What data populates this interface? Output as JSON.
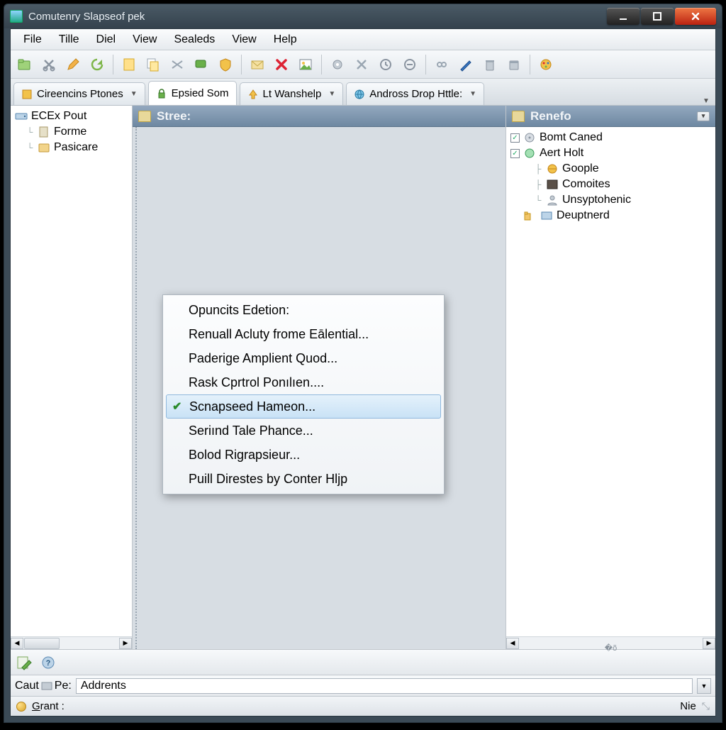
{
  "window": {
    "title": "Comutenry Slapseof pek"
  },
  "menubar": [
    "File",
    "Tille",
    "Diel",
    "View",
    "Sealeds",
    "View",
    "Help"
  ],
  "tabs": [
    {
      "label": "Cireencins Ptones",
      "active": false,
      "icon": "book-icon",
      "hasDropdown": true
    },
    {
      "label": "Epsied Som",
      "active": true,
      "icon": "lock-icon",
      "hasDropdown": false
    },
    {
      "label": "Lt Wanshelp",
      "active": false,
      "icon": "arrow-up-icon",
      "hasDropdown": true
    },
    {
      "label": "Andross Drop Httle:",
      "active": false,
      "icon": "globe-icon",
      "hasDropdown": true
    }
  ],
  "left_tree": [
    {
      "label": "ECEx Pout",
      "icon": "drive-icon",
      "depth": 0
    },
    {
      "label": "Forme",
      "icon": "page-icon",
      "depth": 1
    },
    {
      "label": "Pasicare",
      "icon": "box-icon",
      "depth": 1
    }
  ],
  "mid_header": "Stree:",
  "context_menu": {
    "items": [
      "Opuncits Edetion:",
      "Renuall Acluty frome Eālential...",
      "Paderige Amplient Quod...",
      "Rask Cprtrol Ponılıen....",
      "Scnapseed Hameon...",
      "Seriınd Tale Phance...",
      "Bolod Rigrapsieur...",
      "Puill Direstes by Conter Hljp"
    ],
    "selected_index": 4
  },
  "right_header": "Renefo",
  "right_tree": [
    {
      "label": "Bomt Caned",
      "icon": "disc-icon",
      "depth": 0,
      "checked": true
    },
    {
      "label": "Aert Holt",
      "icon": "globe2-icon",
      "depth": 0,
      "checked": true
    },
    {
      "label": "Goople",
      "icon": "world-icon",
      "depth": 1
    },
    {
      "label": "Comoites",
      "icon": "photo-icon",
      "depth": 1
    },
    {
      "label": "Unsyptohenic",
      "icon": "person-icon",
      "depth": 1
    },
    {
      "label": "Deuptnerd",
      "icon": "picture-icon",
      "depth": 0
    }
  ],
  "address": {
    "label": "Caut",
    "mid_icon_label": "Pe:",
    "value": "Addrents"
  },
  "status": {
    "left": "Grant :",
    "right": "Nie"
  }
}
